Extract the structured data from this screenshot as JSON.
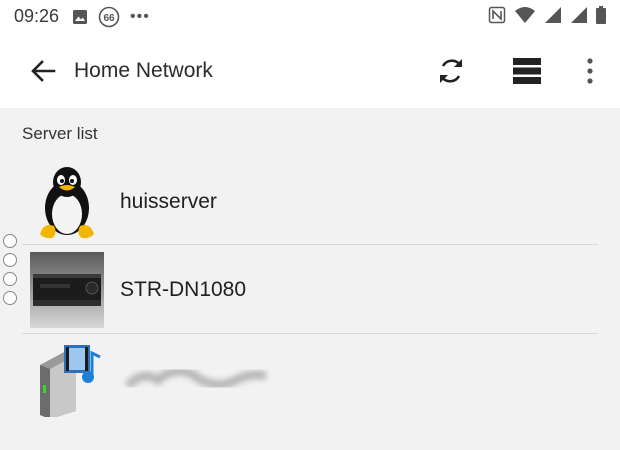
{
  "status_bar": {
    "time": "09:26",
    "notification_badge": "66",
    "overflow_dots": "•••",
    "icons_left": [
      "image-icon",
      "badge-66-icon",
      "more-notifications-icon"
    ],
    "icons_right": [
      "nfc-icon",
      "wifi-icon",
      "signal-icon",
      "signal-icon",
      "battery-icon"
    ]
  },
  "app_bar": {
    "title": "Home Network",
    "actions": [
      "refresh-icon",
      "list-view-icon",
      "more-vert-icon"
    ]
  },
  "content": {
    "section_title": "Server list",
    "servers": [
      {
        "name": "huisserver",
        "icon": "linux-tux-icon"
      },
      {
        "name": "STR-DN1080",
        "icon": "av-receiver-image"
      },
      {
        "name": "",
        "icon": "media-server-icon",
        "name_blurred": true
      }
    ]
  },
  "colors": {
    "app_bar_bg": "#ffffff",
    "content_bg": "#f2f2f2",
    "divider": "#d8d8d8",
    "text": "#212121"
  }
}
